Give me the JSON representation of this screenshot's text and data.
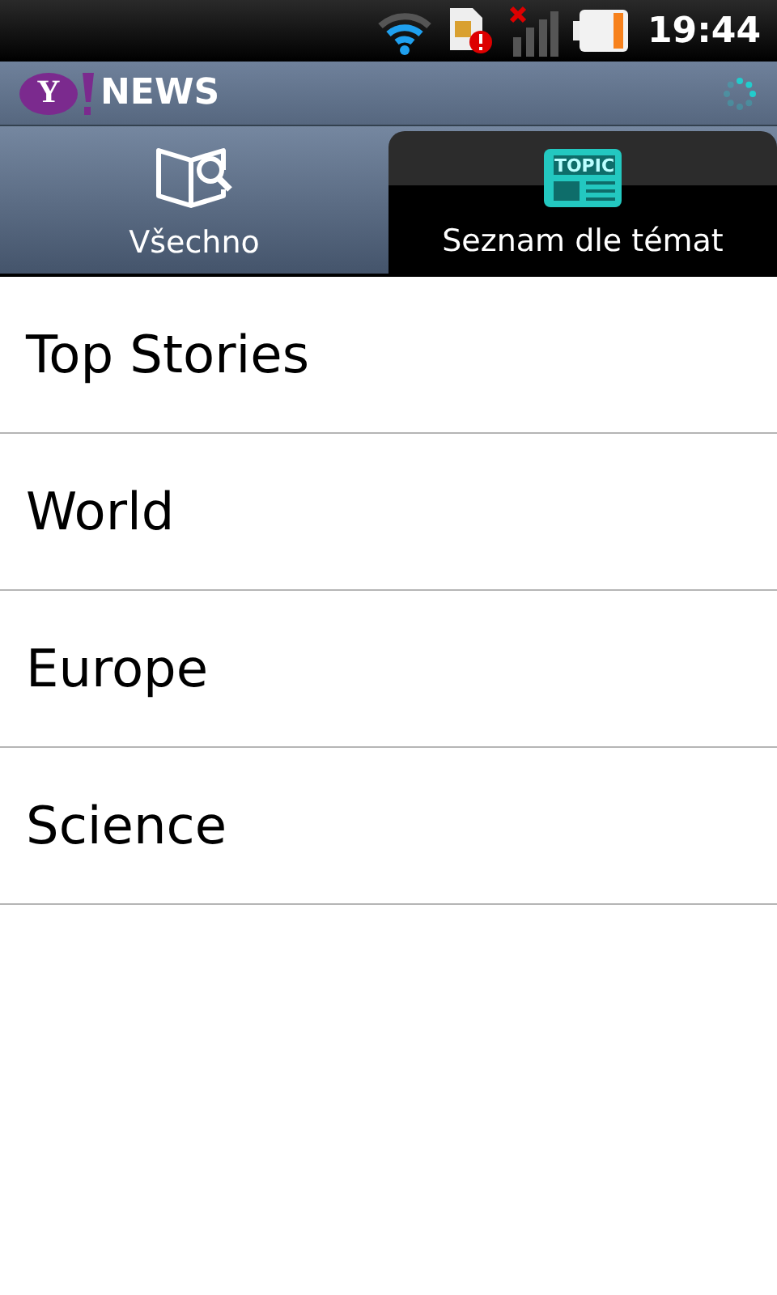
{
  "status_bar": {
    "time": "19:44"
  },
  "header": {
    "logo_mark": "Y",
    "logo_text": "NEWS"
  },
  "tabs": [
    {
      "label": "Všechno",
      "kind": "browse",
      "selected": false
    },
    {
      "label": "Seznam dle témat",
      "kind": "topic",
      "icon_text": "TOPIC",
      "selected": true
    }
  ],
  "topics": [
    "Top Stories",
    "World",
    "Europe",
    "Science"
  ]
}
